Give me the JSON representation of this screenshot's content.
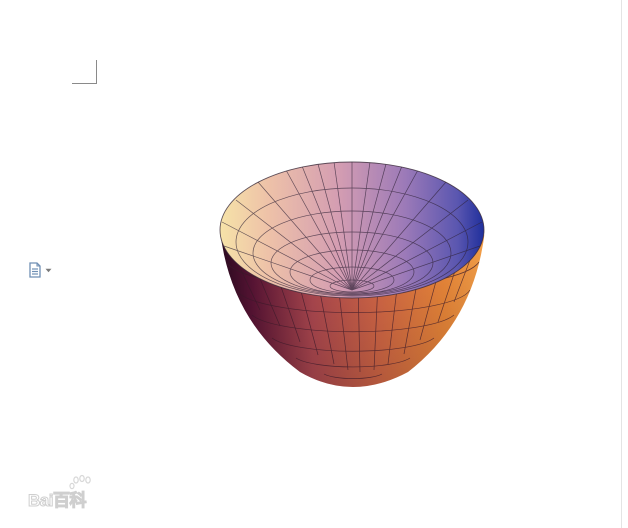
{
  "document": {
    "figure_icon": "paraboloid-3d-plot",
    "colors": {
      "surface_left": "#f3d9a0",
      "surface_mid": "#cf8fa8",
      "surface_right": "#2a3aa8",
      "outer_light": "#e87a4a",
      "outer_dark": "#3a0c2a",
      "mesh": "#3a2a3a"
    }
  },
  "paste_options": {
    "icon": "clipboard-icon",
    "dropdown_icon": "caret-down-icon"
  },
  "watermark": {
    "text": "Bai百科"
  }
}
